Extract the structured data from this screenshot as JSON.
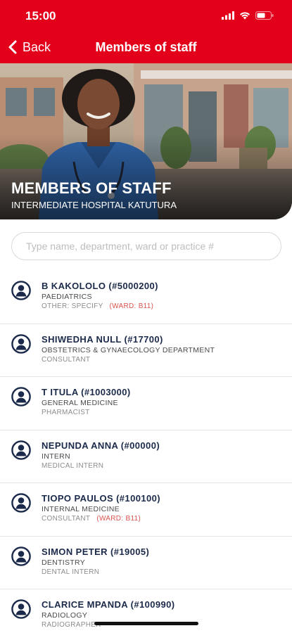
{
  "status_bar": {
    "time": "15:00"
  },
  "nav": {
    "back_label": "Back",
    "title": "Members of staff"
  },
  "hero": {
    "title": "MEMBERS OF STAFF",
    "subtitle": "INTERMEDIATE HOSPITAL KATUTURA"
  },
  "search": {
    "placeholder": "Type name, department, ward or practice #"
  },
  "staff": [
    {
      "name": "B KAKOLOLO (#5000200)",
      "department": "PAEDIATRICS",
      "role": "OTHER: SPECIFY",
      "ward": "(WARD: B11)"
    },
    {
      "name": "SHIWEDHA NULL (#17700)",
      "department": "OBSTETRICS & GYNAECOLOGY DEPARTMENT",
      "role": "CONSULTANT",
      "ward": ""
    },
    {
      "name": "T ITULA (#1003000)",
      "department": "GENERAL MEDICINE",
      "role": "PHARMACIST",
      "ward": ""
    },
    {
      "name": "NEPUNDA ANNA (#00000)",
      "department": "INTERN",
      "role": "MEDICAL INTERN",
      "ward": ""
    },
    {
      "name": "TIOPO PAULOS (#100100)",
      "department": "INTERNAL MEDICINE",
      "role": "CONSULTANT",
      "ward": "(WARD: B11)"
    },
    {
      "name": "SIMON PETER (#19005)",
      "department": "DENTISTRY",
      "role": "DENTAL INTERN",
      "ward": ""
    },
    {
      "name": "CLARICE MPANDA (#100990)",
      "department": "RADIOLOGY",
      "role": "RADIOGRAPHER",
      "ward": ""
    }
  ],
  "colors": {
    "accent": "#e3001b",
    "name_text": "#1b2a4a",
    "ward_text": "#d9534f"
  },
  "icons": {
    "back": "chevron-left-icon",
    "avatar": "person-circle-icon",
    "signal": "signal-icon",
    "wifi": "wifi-icon",
    "battery": "battery-icon"
  }
}
